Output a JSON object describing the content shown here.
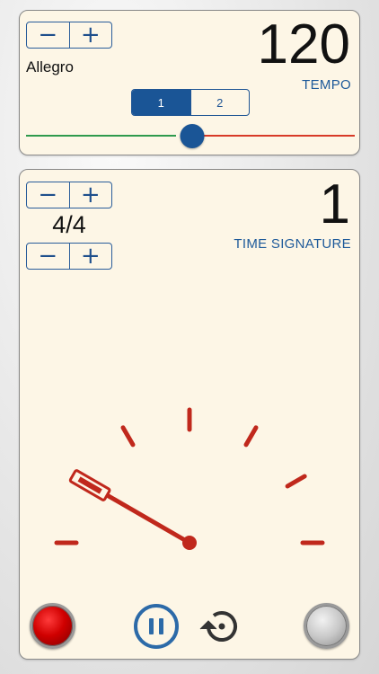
{
  "tempo": {
    "value": "120",
    "label": "TEMPO",
    "name": "Allegro",
    "stepper": {
      "minus": "−",
      "plus": "+"
    },
    "segments": [
      "1",
      "2"
    ],
    "active_segment": 0,
    "slider_fraction": 0.5
  },
  "time_signature": {
    "beat": "1",
    "label": "TIME SIGNATURE",
    "value": "4/4",
    "top_stepper": {
      "minus": "−",
      "plus": "+"
    },
    "bottom_stepper": {
      "minus": "−",
      "plus": "+"
    }
  },
  "gauge": {
    "tick_count": 7,
    "needle_angle_deg": 150
  },
  "controls": {
    "record": "record-button",
    "pause": "pause-icon",
    "reset": "reset-icon",
    "grey": "grey-button"
  },
  "colors": {
    "accent": "#1a5596",
    "tick": "#c0281c",
    "slider_left": "#2f9a4d",
    "slider_right": "#d83a28",
    "panel": "#fdf6e6"
  }
}
